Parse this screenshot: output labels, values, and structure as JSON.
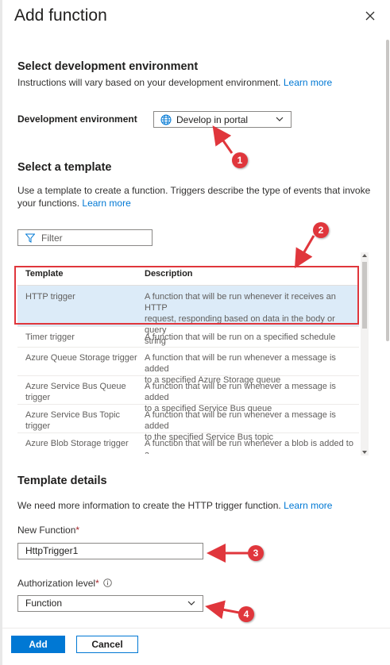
{
  "panel": {
    "title": "Add function",
    "close_icon": "close-icon"
  },
  "dev_env": {
    "heading": "Select development environment",
    "instructions": "Instructions will vary based on your development environment.",
    "learn_more": "Learn more",
    "label": "Development environment",
    "selected": "Develop in portal",
    "icon": "globe-icon"
  },
  "template_section": {
    "heading": "Select a template",
    "desc_line1": "Use a template to create a function. Triggers describe the type of events that invoke",
    "desc_line2": "your functions.",
    "learn_more": "Learn more",
    "filter_placeholder": "Filter",
    "columns": {
      "template": "Template",
      "description": "Description"
    },
    "rows": [
      {
        "template": [
          "HTTP trigger"
        ],
        "description": [
          "A function that will be run whenever it receives an HTTP",
          "request, responding based on data in the body or query",
          "string"
        ],
        "selected": true
      },
      {
        "template": [
          "Timer trigger"
        ],
        "description": [
          "A function that will be run on a specified schedule"
        ],
        "selected": false
      },
      {
        "template": [
          "Azure Queue Storage trigger"
        ],
        "description": [
          "A function that will be run whenever a message is added",
          "to a specified Azure Storage queue"
        ],
        "selected": false
      },
      {
        "template": [
          "Azure Service Bus Queue",
          "trigger"
        ],
        "description": [
          "A function that will be run whenever a message is added",
          "to a specified Service Bus queue"
        ],
        "selected": false
      },
      {
        "template": [
          "Azure Service Bus Topic",
          "trigger"
        ],
        "description": [
          "A function that will be run whenever a message is added",
          "to the specified Service Bus topic"
        ],
        "selected": false
      },
      {
        "template": [
          "Azure Blob Storage trigger"
        ],
        "description": [
          "A function that will be run whenever a blob is added to a",
          "specified container"
        ],
        "selected": false
      }
    ]
  },
  "details": {
    "heading": "Template details",
    "info": "We need more information to create the HTTP trigger function.",
    "learn_more": "Learn more",
    "new_function_label": "New Function",
    "required_mark": "*",
    "new_function_value": "HttpTrigger1",
    "auth_label": "Authorization level",
    "auth_value": "Function"
  },
  "footer": {
    "add_label": "Add",
    "cancel_label": "Cancel"
  },
  "callouts": [
    "1",
    "2",
    "3",
    "4"
  ],
  "colors": {
    "accent": "#0078d4",
    "callout_red": "#e0363c",
    "selected_row": "#dcebf8"
  }
}
